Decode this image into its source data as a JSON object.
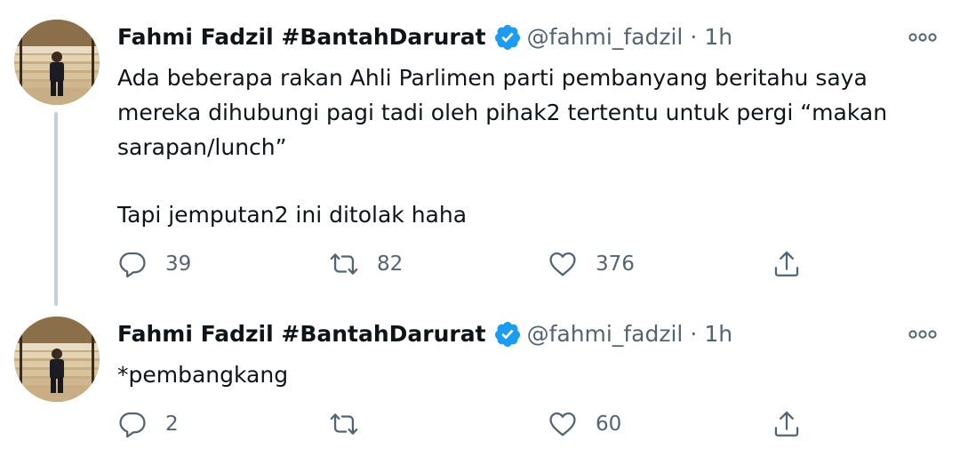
{
  "tweets": [
    {
      "author_name": "Fahmi Fadzil #BantahDarurat",
      "handle": "@fahmi_fadzil",
      "separator": "·",
      "time": "1h",
      "lines": [
        "Ada beberapa rakan Ahli Parlimen parti pembanyang beritahu saya",
        "mereka dihubungi pagi tadi oleh pihak2 tertentu untuk pergi “makan",
        "sarapan/lunch”",
        "Tapi jemputan2 ini ditolak haha"
      ],
      "replies": "39",
      "retweets": "82",
      "likes": "376"
    },
    {
      "author_name": "Fahmi Fadzil #BantahDarurat",
      "handle": "@fahmi_fadzil",
      "separator": "·",
      "time": "1h",
      "lines": [
        "*pembangkang"
      ],
      "replies": "2",
      "retweets": "",
      "likes": "60"
    }
  ],
  "icons": {
    "verified": "verified-badge-icon",
    "more": "more-options-icon",
    "reply": "reply-icon",
    "retweet": "retweet-icon",
    "like": "like-icon",
    "share": "share-icon"
  },
  "colors": {
    "text": "#0f1419",
    "secondary": "#536471",
    "verified": "#1d9bf0",
    "thread_line": "#c4cfd6"
  }
}
